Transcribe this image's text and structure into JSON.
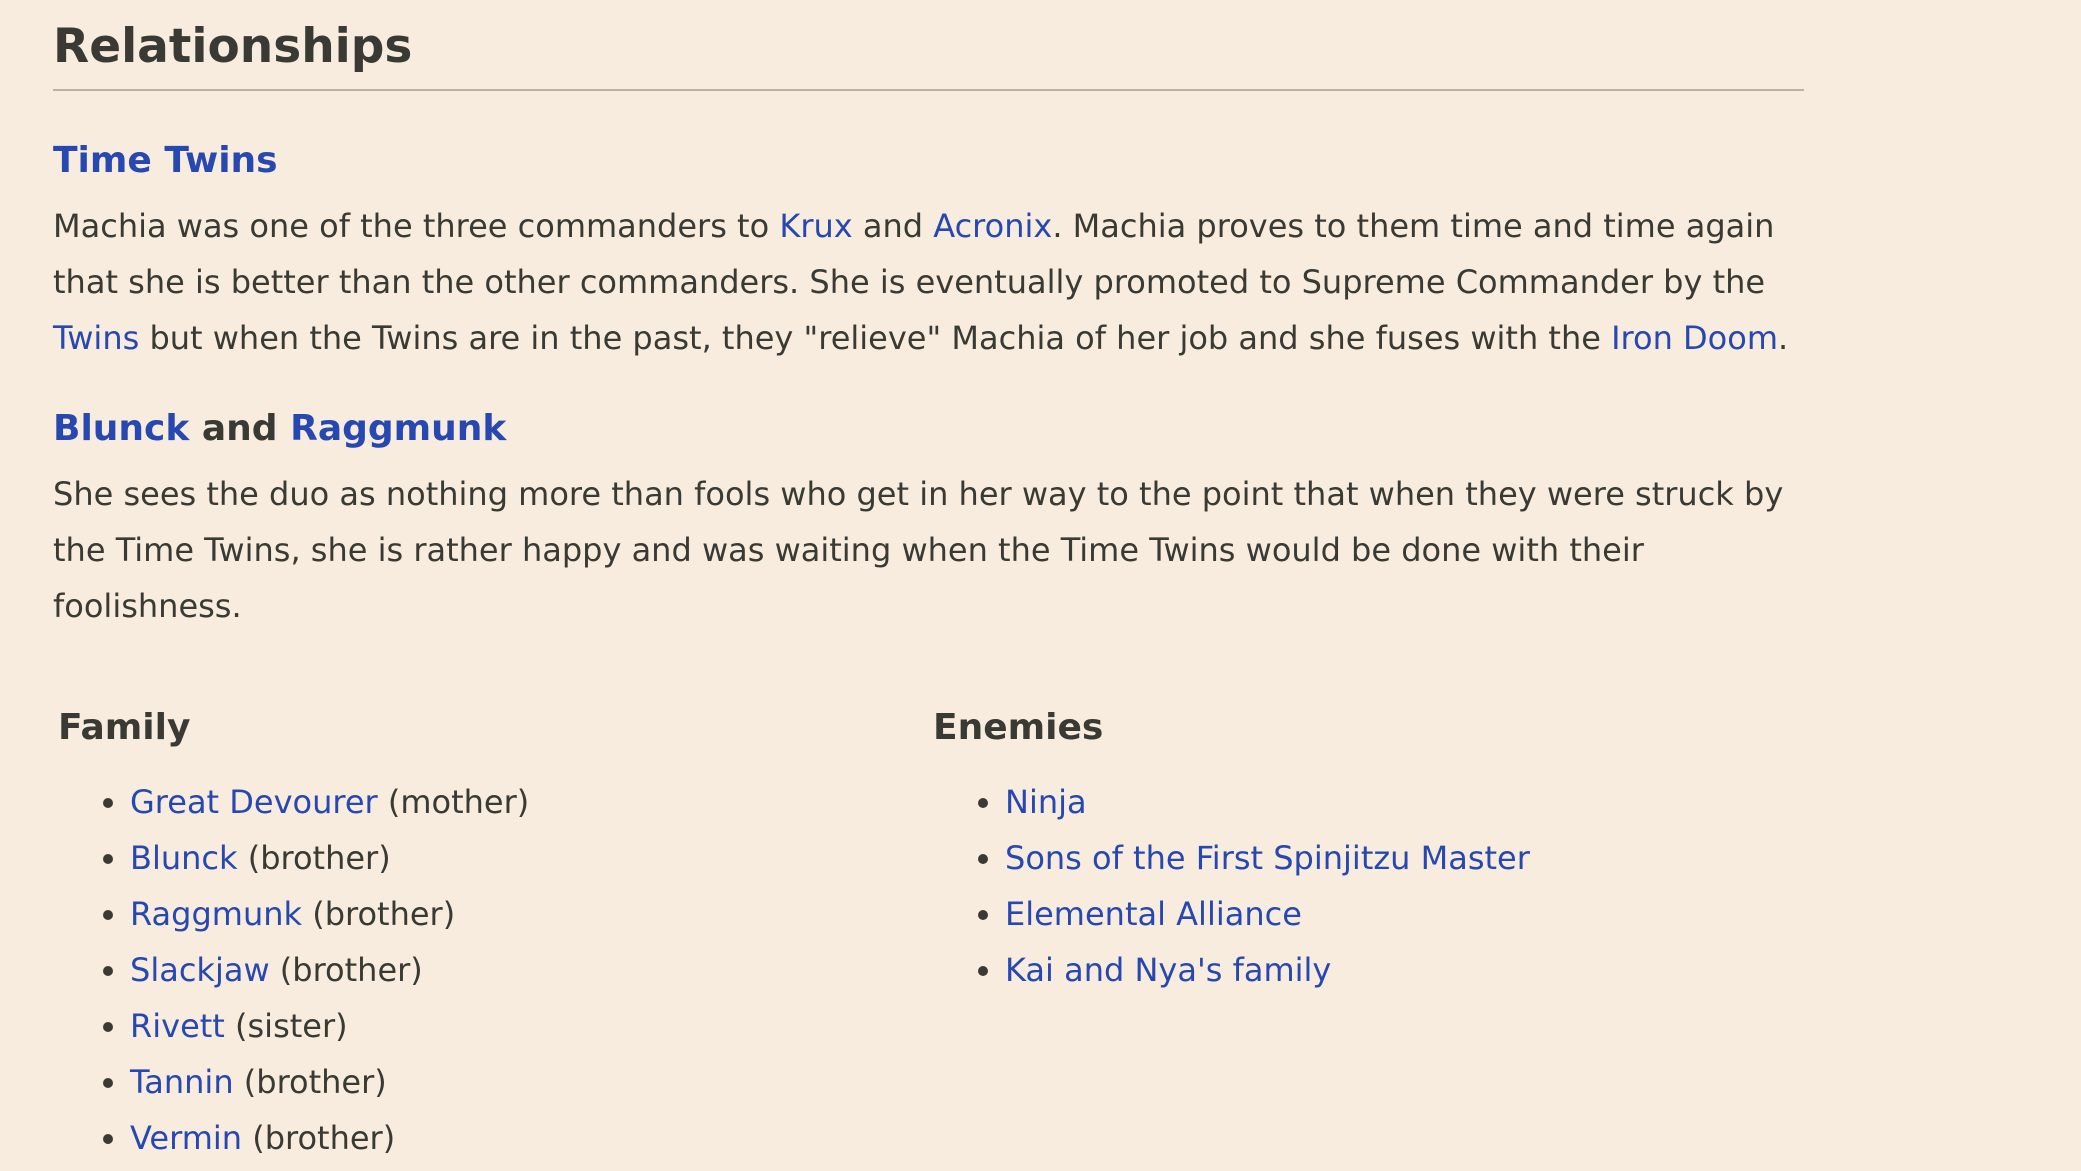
{
  "section": {
    "title": "Relationships"
  },
  "time_twins": {
    "heading": "Time Twins",
    "p1": "Machia was one of the three commanders to ",
    "link_krux": "Krux",
    "and": " and ",
    "link_acronix": "Acronix",
    "p2": ". Machia proves to them time and time again that she is better than the other commanders. She is eventually promoted to Supreme Commander by the ",
    "link_twins": "Twins",
    "p3": " but when the Twins are in the past, they \"relieve\" Machia of her job and she fuses with the ",
    "link_iron_doom": "Iron Doom",
    "p4": "."
  },
  "blunck_raggmunk": {
    "heading_link1": "Blunck",
    "heading_and": " and ",
    "heading_link2": "Raggmunk",
    "text": "She sees the duo as nothing more than fools who get in her way to the point that when they were struck by the Time Twins, she is rather happy and was waiting when the Time Twins would be done with their foolishness."
  },
  "family": {
    "heading": "Family",
    "items": [
      {
        "name": "Great Devourer",
        "relation": " (mother)"
      },
      {
        "name": "Blunck",
        "relation": " (brother)"
      },
      {
        "name": "Raggmunk",
        "relation": " (brother)"
      },
      {
        "name": "Slackjaw",
        "relation": " (brother)"
      },
      {
        "name": "Rivett",
        "relation": " (sister)"
      },
      {
        "name": "Tannin",
        "relation": " (brother)"
      },
      {
        "name": "Vermin",
        "relation": " (brother)"
      }
    ]
  },
  "enemies": {
    "heading": "Enemies",
    "items": [
      {
        "name": "Ninja"
      },
      {
        "name": "Sons of the First Spinjitzu Master"
      },
      {
        "name": "Elemental Alliance"
      },
      {
        "name": "Kai and Nya's family"
      }
    ]
  },
  "colors": {
    "background": "#f7ecde",
    "text": "#3a3a34",
    "link": "#2748b0"
  }
}
